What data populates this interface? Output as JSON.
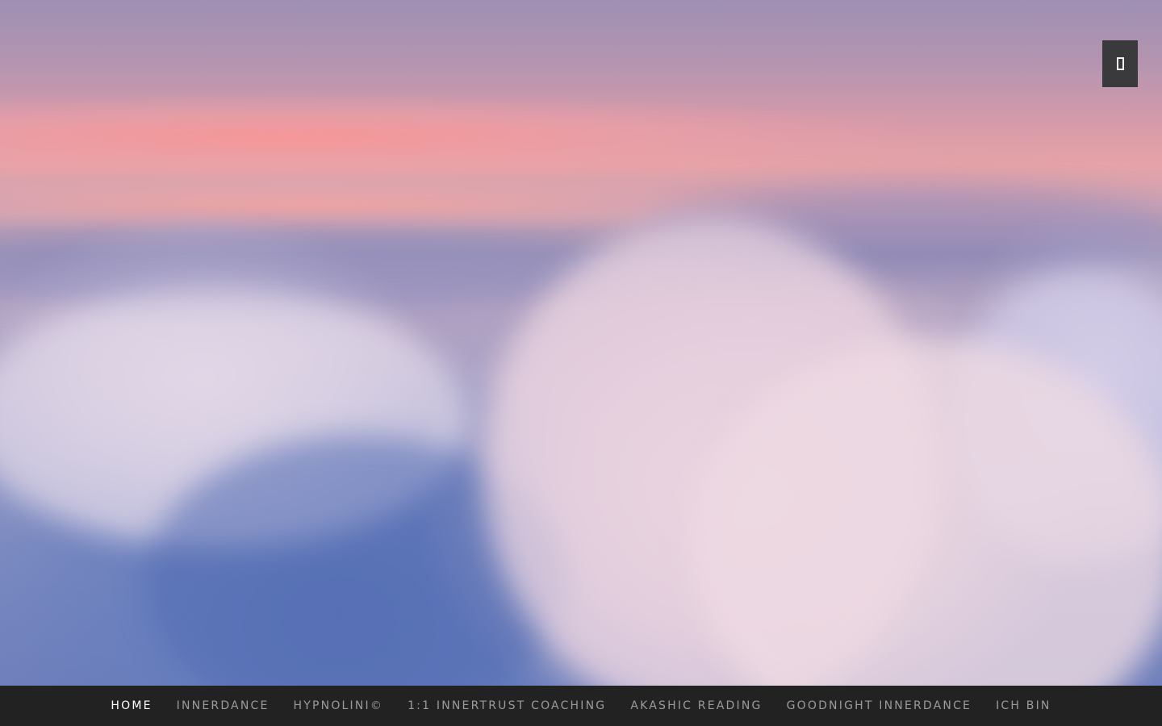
{
  "header": {
    "menu_toggle_icon": "rectangle-icon"
  },
  "nav": {
    "items": [
      {
        "label": "HOME",
        "active": true
      },
      {
        "label": "INNERDANCE",
        "active": false
      },
      {
        "label": "HYPNOLINI©",
        "active": false
      },
      {
        "label": "1:1 INNERTRUST COACHING",
        "active": false
      },
      {
        "label": "AKASHIC READING",
        "active": false
      },
      {
        "label": "GOODNIGHT INNERDANCE",
        "active": false
      },
      {
        "label": "ICH BIN",
        "active": false
      }
    ]
  },
  "colors": {
    "navbar_bg": "#222222",
    "nav_text": "#9b9b9b",
    "nav_active_text": "#ffffff",
    "toggle_bg": "#3a3a3c"
  }
}
